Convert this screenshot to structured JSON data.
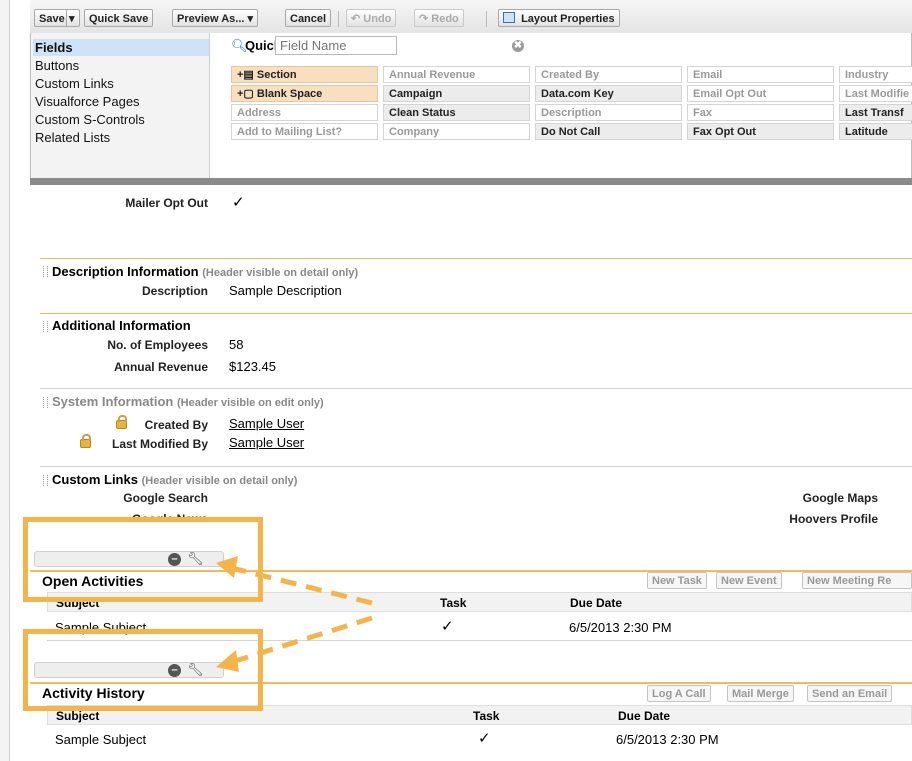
{
  "toolbar": {
    "save": "Save",
    "save_menu": "▾",
    "quick_save": "Quick Save",
    "preview_as": "Preview As... ▾",
    "cancel": "Cancel",
    "undo": "Undo",
    "redo": "Redo",
    "layout_properties": "Layout Properties"
  },
  "palette": {
    "categories": [
      "Fields",
      "Buttons",
      "Custom Links",
      "Visualforce Pages",
      "Custom S-Controls",
      "Related Lists"
    ],
    "quick_find_label": "Quick Find",
    "quick_find_placeholder": "Field Name",
    "quick_find_clear": "✖",
    "fields": [
      [
        "+▤ Section",
        "Annual Revenue",
        "Created By",
        "Email",
        "Industry"
      ],
      [
        "+▢ Blank Space",
        "Campaign",
        "Data.com Key",
        "Email Opt Out",
        "Last Modifie"
      ],
      [
        "Address",
        "Clean Status",
        "Description",
        "Fax",
        "Last Transf"
      ],
      [
        "Add to Mailing List?",
        "Company",
        "Do Not Call",
        "Fax Opt Out",
        "Latitude"
      ]
    ]
  },
  "layout": {
    "mailer_opt_out_label": "Mailer Opt Out",
    "mailer_opt_out_value": "✓",
    "description_section": "Description Information",
    "description_section_note": "(Header visible on detail only)",
    "description_label": "Description",
    "description_value": "Sample Description",
    "additional_section": "Additional Information",
    "employees_label": "No. of Employees",
    "employees_value": "58",
    "annual_revenue_label": "Annual Revenue",
    "annual_revenue_value": "$123.45",
    "system_section": "System Information",
    "system_section_note": "(Header visible on edit only)",
    "created_by_label": "Created By",
    "created_by_value": "Sample User",
    "last_modified_label": "Last Modified By",
    "last_modified_value": "Sample User",
    "custom_links_section": "Custom Links",
    "custom_links_note": "(Header visible on detail only)",
    "google_search": "Google Search",
    "google_news": "Google News",
    "google_maps": "Google Maps",
    "hoovers_profile": "Hoovers Profile"
  },
  "open_activities": {
    "title": "Open Activities",
    "buttons": [
      "New Task",
      "New Event",
      "New Meeting Re"
    ],
    "columns": [
      "Subject",
      "Task",
      "Due Date"
    ],
    "row": [
      "Sample Subject",
      "✓",
      "6/5/2013 2:30 PM"
    ]
  },
  "activity_history": {
    "title": "Activity History",
    "buttons": [
      "Log A Call",
      "Mail Merge",
      "Send an Email"
    ],
    "columns": [
      "Subject",
      "Task",
      "Due Date"
    ],
    "row": [
      "Sample Subject",
      "✓",
      "6/5/2013 2:30 PM"
    ]
  },
  "icons": {
    "minus": "–",
    "wrench": "🔧"
  },
  "colors": {
    "accent_orange": "#f5b44a",
    "palette_selected": "#cfe2f7",
    "special_field": "#f8dfc0"
  }
}
